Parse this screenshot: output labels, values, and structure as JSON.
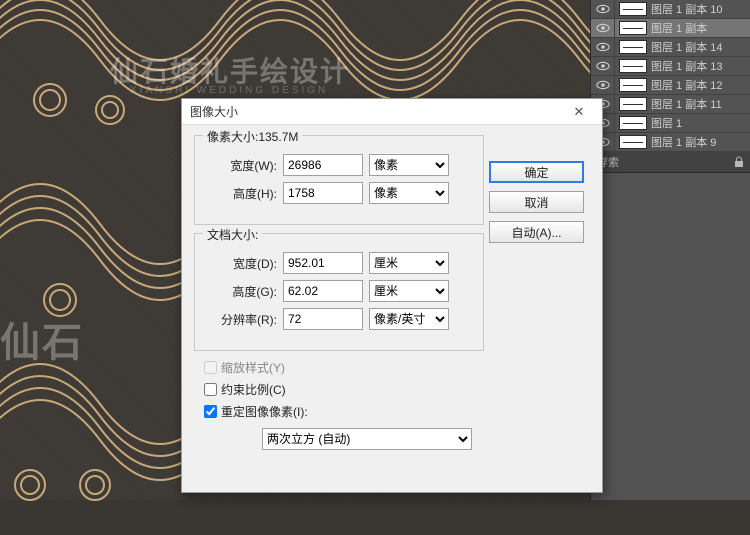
{
  "dialog": {
    "title": "图像大小",
    "pixel_dims_legend": "像素大小:135.7M",
    "doc_size_legend": "文档大小:",
    "width_label": "宽度(W):",
    "height_label": "高度(H):",
    "width_label2": "宽度(D):",
    "height_label2": "高度(G):",
    "res_label": "分辨率(R):",
    "width_px": "26986",
    "height_px": "1758",
    "unit_px": "像素",
    "width_cm": "952.01",
    "height_cm": "62.02",
    "unit_cm": "厘米",
    "resolution": "72",
    "res_unit": "像素/英寸",
    "scale_styles": "缩放样式(Y)",
    "constrain": "约束比例(C)",
    "resample": "重定图像像素(I):",
    "resample_method": "两次立方 (自动)",
    "ok": "确定",
    "cancel": "取消",
    "auto": "自动(A)..."
  },
  "layers": [
    {
      "name": "图层 1 副本 10"
    },
    {
      "name": "图层 1 副本"
    },
    {
      "name": "图层 1 副本 14"
    },
    {
      "name": "图层 1 副本 13"
    },
    {
      "name": "图层 1 副本 12"
    },
    {
      "name": "图层 1 副本 11"
    },
    {
      "name": "图层 1"
    },
    {
      "name": "图层 1 副本 9"
    }
  ],
  "panel_extra": "穿索",
  "watermark": "仙石婚礼手绘设计",
  "watermark_sub": "XIANSHI WEDDING DESIGN"
}
